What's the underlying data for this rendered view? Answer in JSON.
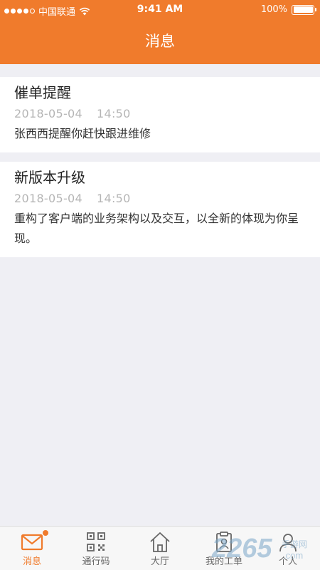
{
  "status_bar": {
    "carrier": "中国联通",
    "time": "9:41 AM",
    "battery": "100%"
  },
  "nav": {
    "title": "消息"
  },
  "messages": [
    {
      "title": "催单提醒",
      "date": "2018-05-04",
      "time": "14:50",
      "body": "张西西提醒你赶快跟进维修"
    },
    {
      "title": "新版本升级",
      "date": "2018-05-04",
      "time": "14:50",
      "body": "重构了客户端的业务架构以及交互，以全新的体现为你呈现。"
    }
  ],
  "tabbar": {
    "tabs": [
      {
        "label": "消息",
        "icon": "mail-icon",
        "active": true
      },
      {
        "label": "通行码",
        "icon": "qrcode-icon",
        "active": false
      },
      {
        "label": "大厅",
        "icon": "home-icon",
        "active": false
      },
      {
        "label": "我的工单",
        "icon": "clipboard-icon",
        "active": false
      },
      {
        "label": "个人",
        "icon": "person-icon",
        "active": false
      }
    ]
  },
  "watermark": {
    "text": "2265",
    "suffix": "手游网",
    "domain": ".com"
  },
  "colors": {
    "accent": "#f07b2c",
    "background": "#efeff4"
  }
}
